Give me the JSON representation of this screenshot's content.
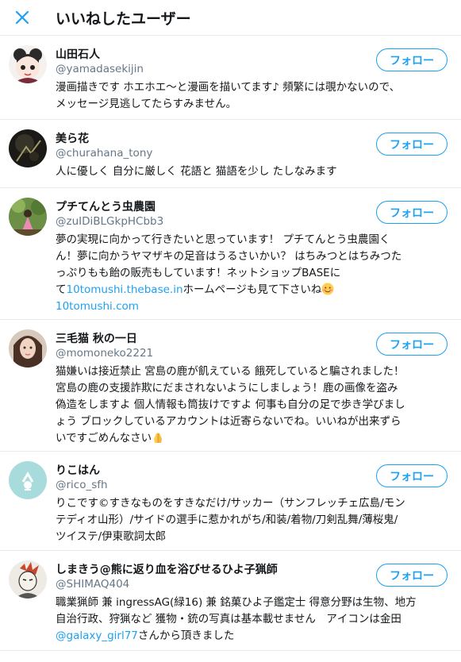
{
  "header": {
    "title": "いいねしたユーザー"
  },
  "follow_label": "フォロー",
  "accent_color": "#1da1f2",
  "users": [
    {
      "name": "山田石人",
      "handle": "@yamadasekijin",
      "bio": [
        "漫画描きです ホエホエ〜と漫画を描いてます♪ 頻繁には覗かないので、",
        "メッセージ見逃してたらすみません。"
      ]
    },
    {
      "name": "美ら花",
      "handle": "@churahana_tony",
      "bio": [
        "人に優しく 自分に厳しく 花語と 猫語を少し たしなみます"
      ]
    },
    {
      "name": "プチてんとう虫農園",
      "handle": "@zuIDiBLGkpHCbb3",
      "bio": [
        "夢の実現に向かって行きたいと思っています！ プチてんとう虫農園く",
        "ん！夢に向かうヤマザキの足音はうるさいかい？ はちみつとはちみつた",
        "っぷりもも飴の販売もしています！ネットショップBASEに"
      ],
      "bio_line4_pre": "て",
      "bio_link1": "10tomushi.thebase.in",
      "bio_line4_post": "ホームページも見て下さいね",
      "bio_link2": "10tomushi.com"
    },
    {
      "name": "三毛猫 秋の一日",
      "handle": "@momoneko2221",
      "bio": [
        "猫嫌いは接近禁止 宮島の鹿が飢えている 餓死していると騙されました！",
        "宮島の鹿の支援詐欺にだまされないようにしましょう！鹿の画像を盗み",
        "偽造をしますよ 個人情報も筒抜けですよ 何事も自分の足で歩き学びまし",
        "ょう ブロックしているアカウントは近寄らないでね。いいねが出来ずら"
      ],
      "bio_last": "いですごめんなさい"
    },
    {
      "name": "りこはん",
      "handle": "@rico_sfh",
      "bio": [
        "りこです©すきなものをすきなだけ/サッカー（サンフレッチェ広島/モン",
        "テディオ山形）/サイドの選手に惹かれがち/和装/着物/刀剣乱舞/薄桜鬼/",
        "ツイステ/伊東歌詞太郎"
      ]
    },
    {
      "name": "しまきう@熊に返り血を浴びせるひよ子猟師",
      "handle": "@SHIMAQ404",
      "bio": [
        "職業猟師 兼 ingressAG(緑16) 兼 銘菓ひよ子鑑定士 得意分野は生物、地方",
        "自治行政、狩猟など 獲物・銃の写真は基本載せません　アイコンは金田"
      ],
      "bio_link": "@galaxy_girl77",
      "bio_last": "さんから頂きました"
    }
  ]
}
